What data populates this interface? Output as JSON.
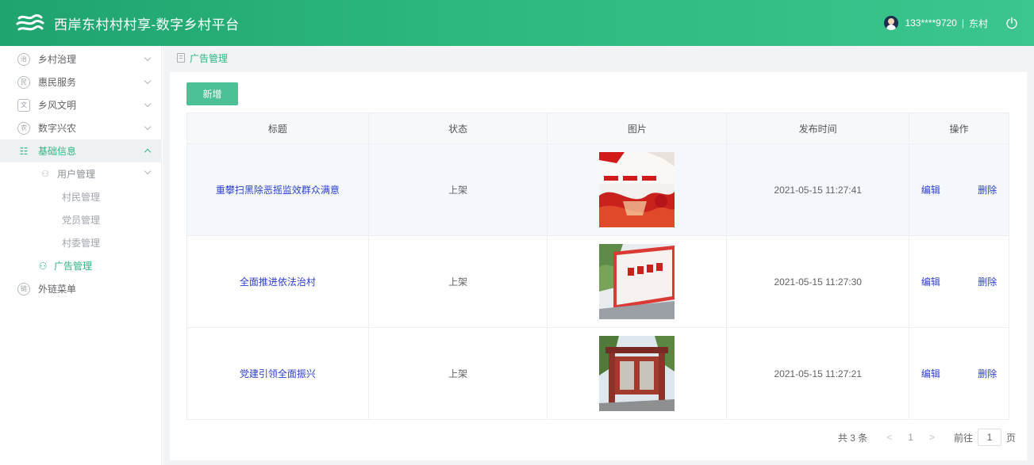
{
  "app": {
    "title": "西岸东村村村享-数字乡村平台",
    "user": "133****9720",
    "separator": "|",
    "village": "东村",
    "accent_color": "#2fb57f"
  },
  "sidebar": {
    "items": [
      {
        "label": "乡村治理",
        "icon": "village-governance-icon"
      },
      {
        "label": "惠民服务",
        "icon": "public-service-icon"
      },
      {
        "label": "乡风文明",
        "icon": "civilization-icon"
      },
      {
        "label": "数字兴农",
        "icon": "digital-agriculture-icon"
      },
      {
        "label": "基础信息",
        "icon": "basic-info-icon"
      },
      {
        "label": "外链菜单",
        "icon": "external-link-icon"
      }
    ],
    "sub_group": {
      "label": "用户管理",
      "icon": "users-icon"
    },
    "leaves": [
      "村民管理",
      "党员管理",
      "村委管理"
    ],
    "active_leaf": {
      "label": "广告管理",
      "icon": "ad-icon"
    }
  },
  "breadcrumb": {
    "label": "广告管理"
  },
  "toolbar": {
    "add_label": "新增"
  },
  "table": {
    "headers": [
      "标题",
      "状态",
      "图片",
      "发布时间",
      "操作"
    ],
    "rows": [
      {
        "title": "重攀扫黑除恶摇监效群众满意",
        "status": "上架",
        "image": "red-banner-poster",
        "time": "2021-05-15 11:27:41"
      },
      {
        "title": "全面推进依法治村",
        "status": "上架",
        "image": "village-wall-slogan",
        "time": "2021-05-15 11:27:30"
      },
      {
        "title": "党建引领全面振兴",
        "status": "上架",
        "image": "memorial-archway",
        "time": "2021-05-15 11:27:21"
      }
    ],
    "edit_label": "编辑",
    "delete_label": "删除"
  },
  "pagination": {
    "total": "共 3 条",
    "prev": "<",
    "current": "1",
    "next": ">",
    "goto": "前往",
    "page_value": "1",
    "page_suffix": "页"
  }
}
